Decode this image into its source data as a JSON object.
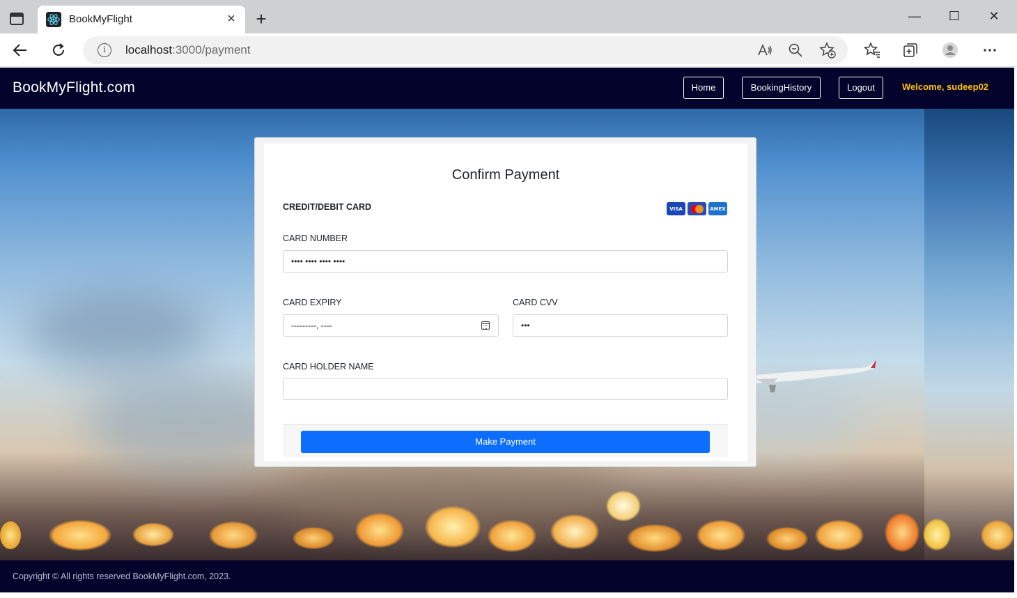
{
  "browser": {
    "tab_title": "BookMyFlight",
    "url_host": "localhost",
    "url_path": ":3000/payment",
    "icons": [
      "tab-actions-icon",
      "react-favicon-icon",
      "close-icon",
      "plus-icon",
      "minimize-icon",
      "maximize-icon",
      "window-close-icon",
      "back-arrow-icon",
      "refresh-icon",
      "info-icon",
      "read-aloud-icon",
      "zoom-out-icon",
      "add-favorite-icon",
      "favorites-icon",
      "collections-icon",
      "profile-icon",
      "more-icon"
    ]
  },
  "app": {
    "brand": "BookMyFlight.com",
    "nav": {
      "home": "Home",
      "booking_history": "BookingHistory",
      "logout": "Logout",
      "welcome": "Welcome, sudeep02"
    },
    "welcome_color": "#ffc107",
    "nav_bg": "#03032c"
  },
  "payment": {
    "title": "Confirm Payment",
    "method_label": "CREDIT/DEBIT CARD",
    "card_logos": [
      "VISA",
      "",
      "AMEX"
    ],
    "card_number_label": "CARD NUMBER",
    "card_number_placeholder": "•••• •••• •••• ••••",
    "card_expiry_label": "CARD EXPIRY",
    "card_expiry_placeholder": "---------, ----",
    "card_cvv_label": "CARD CVV",
    "card_cvv_placeholder": "•••",
    "card_holder_label": "CARD HOLDER NAME",
    "card_holder_value": "",
    "submit_label": "Make Payment",
    "accent": "#0d6efd"
  },
  "footer": {
    "copyright": "Copyright © All rights reserved BookMyFlight.com, 2023."
  }
}
